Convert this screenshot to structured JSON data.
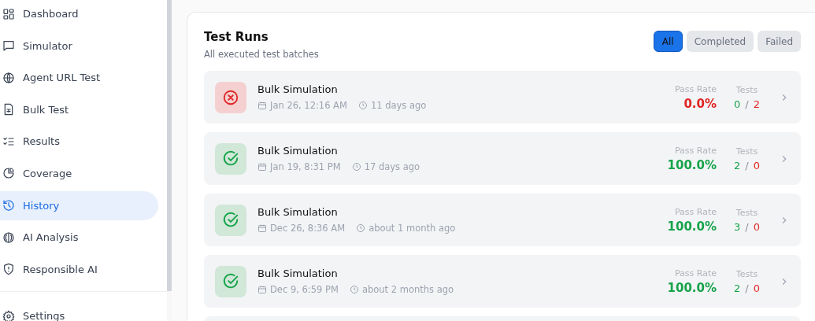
{
  "sidebar": {
    "items": [
      {
        "label": "Dashboard",
        "selected": false
      },
      {
        "label": "Simulator",
        "selected": false
      },
      {
        "label": "Agent URL Test",
        "selected": false
      },
      {
        "label": "Bulk Test",
        "selected": false
      },
      {
        "label": "Results",
        "selected": false
      },
      {
        "label": "Coverage",
        "selected": false
      },
      {
        "label": "History",
        "selected": true
      },
      {
        "label": "AI Analysis",
        "selected": false
      },
      {
        "label": "Responsible AI",
        "selected": false
      }
    ],
    "footer_items": [
      {
        "label": "Settings"
      }
    ]
  },
  "card": {
    "title": "Test Runs",
    "subtitle": "All executed test batches",
    "filters": [
      {
        "label": "All",
        "selected": true
      },
      {
        "label": "Completed",
        "selected": false
      },
      {
        "label": "Failed",
        "selected": false
      }
    ],
    "runs": [
      {
        "kind": "failed",
        "name": "Bulk Simulation",
        "date": "Jan 26, 12:16 AM",
        "ago": "11 days ago",
        "rate_label": "Pass Rate",
        "pass_rate": "0.0%",
        "tests_label": "Tests",
        "passed": "0",
        "separator": "/",
        "failed": "2"
      },
      {
        "kind": "passed",
        "name": "Bulk Simulation",
        "date": "Jan 19, 8:31 PM",
        "ago": "17 days ago",
        "rate_label": "Pass Rate",
        "pass_rate": "100.0%",
        "tests_label": "Tests",
        "passed": "2",
        "separator": "/",
        "failed": "0"
      },
      {
        "kind": "passed",
        "name": "Bulk Simulation",
        "date": "Dec 26, 8:36 AM",
        "ago": "about 1 month ago",
        "rate_label": "Pass Rate",
        "pass_rate": "100.0%",
        "tests_label": "Tests",
        "passed": "3",
        "separator": "/",
        "failed": "0"
      },
      {
        "kind": "passed",
        "name": "Bulk Simulation",
        "date": "Dec 9, 6:59 PM",
        "ago": "about 2 months ago",
        "rate_label": "Pass Rate",
        "pass_rate": "100.0%",
        "tests_label": "Tests",
        "passed": "2",
        "separator": "/",
        "failed": "0"
      }
    ]
  }
}
